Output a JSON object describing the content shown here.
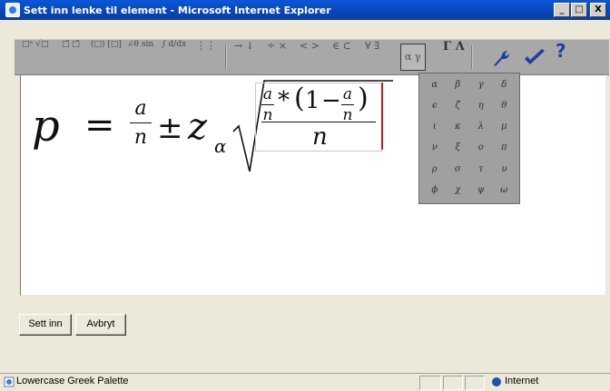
{
  "window": {
    "title": "Sett inn lenke til element - Microsoft Internet Explorer",
    "minimize": "_",
    "maximize": "□",
    "close": "X"
  },
  "toolbar": {
    "groups": {
      "powers": "□ⁿ √□",
      "overbars": "□̄ □̃",
      "brackets": "(□) [□]",
      "angles": "∠θ sin",
      "calculus": "∫ d/dx",
      "matrix": "⋮⋮",
      "arrows": "→ ↓",
      "operators": "÷ ×",
      "relations": "< >",
      "sets": "∈ ⊂",
      "logic": "∀ ∃",
      "lower_greek": "α γ",
      "upper_greek": "Γ Λ"
    },
    "tools": {
      "settings_icon": "wrench-icon",
      "check_icon": "checkmark-icon",
      "help_label": "?"
    }
  },
  "formula": {
    "lhs": "p",
    "equals": "=",
    "frac": {
      "num": "a",
      "den": "n"
    },
    "plusminus": "±",
    "z": "z",
    "subscript": "α",
    "inner": {
      "num_a": "a",
      "num_n": "n",
      "times": "*",
      "lparen": "(",
      "one": "1",
      "minus": "−",
      "inner_a": "a",
      "inner_n": "n",
      "rparen": ")",
      "den": "n"
    }
  },
  "palette": {
    "symbols": [
      "α",
      "β",
      "γ",
      "δ",
      "ϵ",
      "ζ",
      "η",
      "θ",
      "ι",
      "κ",
      "λ",
      "μ",
      "ν",
      "ξ",
      "ο",
      "π",
      "ρ",
      "σ",
      "τ",
      "υ",
      "ϕ",
      "χ",
      "ψ",
      "ω"
    ]
  },
  "buttons": {
    "insert": "Sett inn",
    "cancel": "Avbryt"
  },
  "statusbar": {
    "text": "Lowercase Greek Palette",
    "zone": "Internet"
  },
  "colors": {
    "titlebar": "#0a56d8",
    "toolbar": "#a8a8a8",
    "cursor": "#d21818",
    "palette": "#a0a0a0"
  }
}
